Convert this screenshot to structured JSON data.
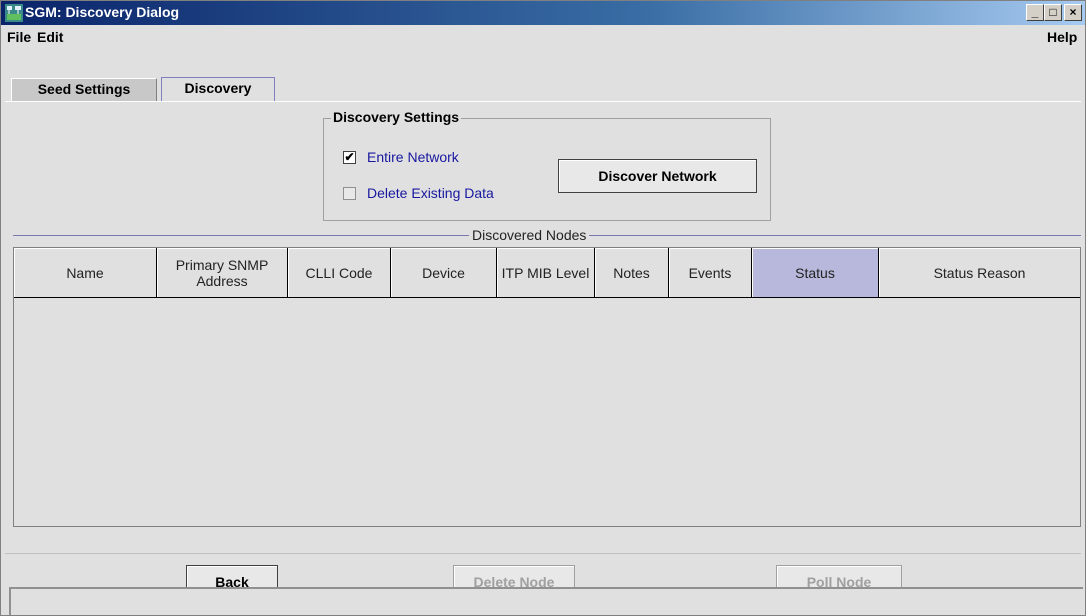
{
  "window": {
    "title": "SGM: Discovery Dialog",
    "controls": {
      "minimize": "_",
      "maximize": "□",
      "close": "×"
    }
  },
  "menu": {
    "file": "File",
    "edit": "Edit",
    "help": "Help"
  },
  "tabs": [
    {
      "label": "Seed Settings",
      "selected": false
    },
    {
      "label": "Discovery",
      "selected": true
    }
  ],
  "settings": {
    "title": "Discovery Settings",
    "entire_network": {
      "label": "Entire Network",
      "checked": true,
      "mark": "✔"
    },
    "delete_existing": {
      "label": "Delete Existing Data",
      "checked": false,
      "enabled": false
    },
    "discover_button": "Discover Network"
  },
  "nodes": {
    "title": "Discovered Nodes",
    "columns": [
      "Name",
      "Primary SNMP Address",
      "CLLI Code",
      "Device",
      "ITP MIB Level",
      "Notes",
      "Events",
      "Status",
      "Status Reason"
    ],
    "sorted_column": "Status",
    "rows": []
  },
  "buttons": {
    "back": "Back",
    "delete_node": "Delete Node",
    "poll_node": "Poll Node"
  },
  "colors": {
    "title_bar": "#0a246a",
    "sorted_header": "#b8b8dc",
    "link_text": "#1818a0"
  }
}
